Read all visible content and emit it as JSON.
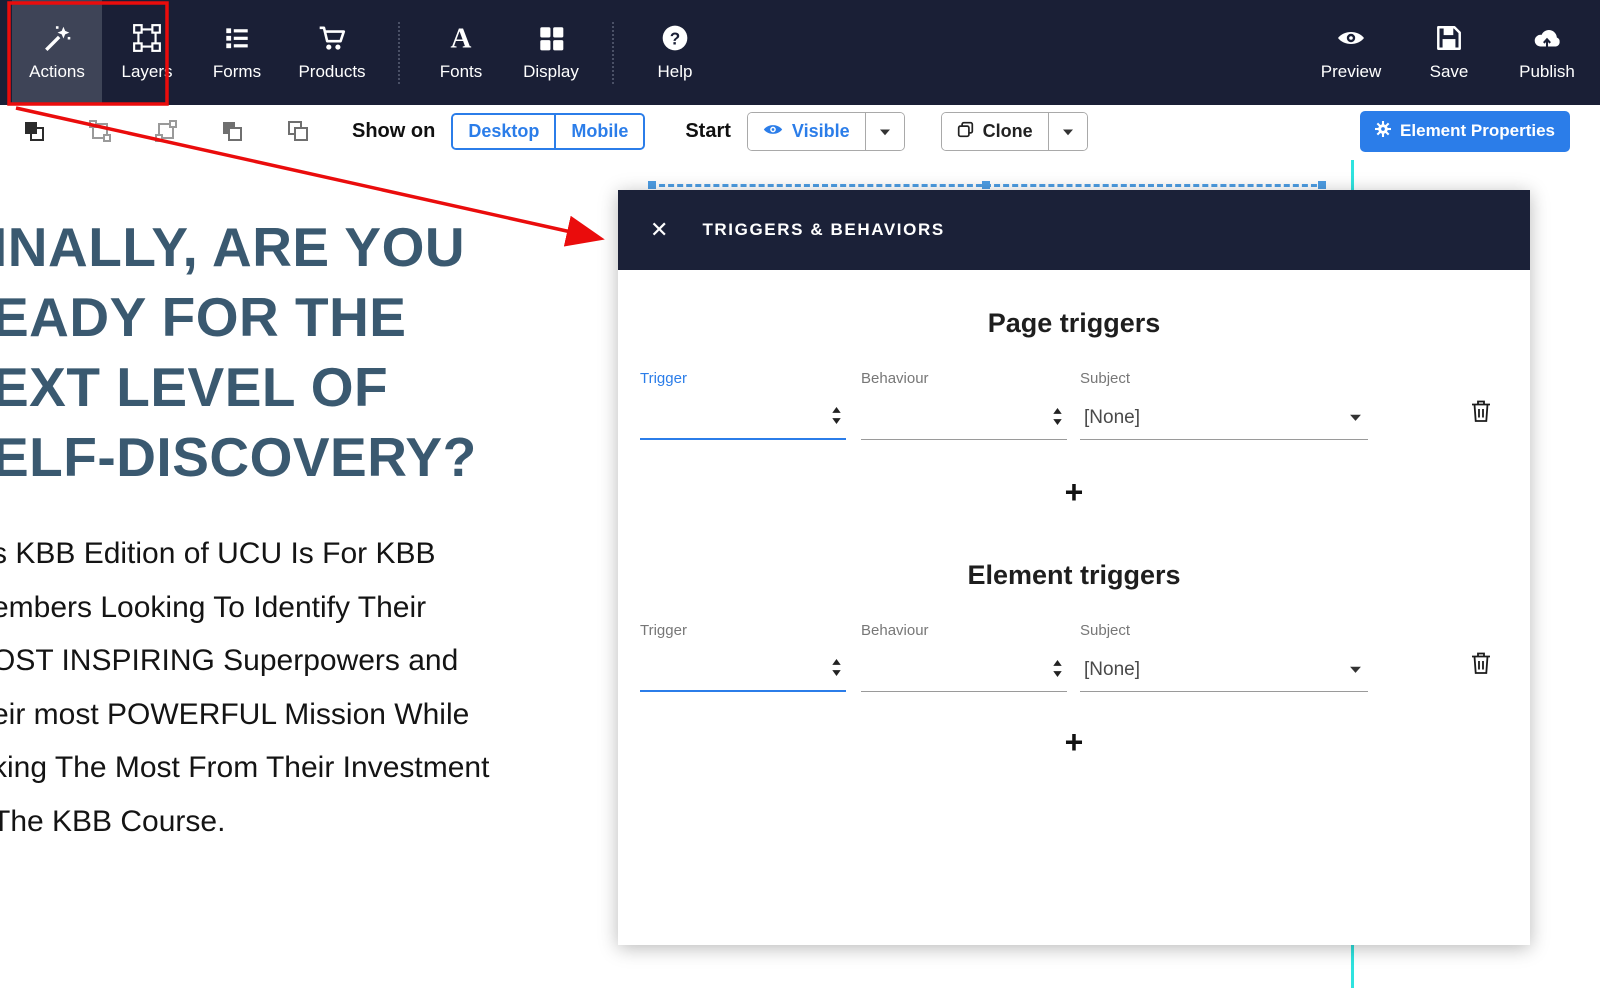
{
  "colors": {
    "topbar_bg": "#1a1f36",
    "accent_blue": "#2b7de9",
    "heading_color": "#3a5970",
    "annotation_red": "#ea0c0c",
    "guide_cyan": "#2fe3df",
    "modal_header_bg": "#1b2138"
  },
  "topbar": {
    "items": [
      {
        "label": "Actions",
        "icon": "magic-wand-icon",
        "active": true
      },
      {
        "label": "Layers",
        "icon": "selection-layers-icon",
        "active": false
      },
      {
        "label": "Forms",
        "icon": "list-forms-icon",
        "active": false
      },
      {
        "label": "Products",
        "icon": "shopping-cart-icon",
        "active": false
      },
      {
        "label": "Fonts",
        "icon": "letter-a-icon",
        "active": false
      },
      {
        "label": "Display",
        "icon": "grid-display-icon",
        "active": false
      },
      {
        "label": "Help",
        "icon": "question-circle-icon",
        "active": false
      }
    ],
    "right_items": [
      {
        "label": "Preview",
        "icon": "eye-icon"
      },
      {
        "label": "Save",
        "icon": "floppy-save-icon"
      },
      {
        "label": "Publish",
        "icon": "cloud-upload-icon"
      }
    ]
  },
  "toolbar": {
    "show_on_label": "Show on",
    "device_options": [
      "Desktop",
      "Mobile"
    ],
    "start_label": "Start",
    "visibility": {
      "label": "Visible",
      "icon": "eye-icon"
    },
    "clone_label": "Clone",
    "clone_icon": "copy-icon",
    "element_properties_label": "Element Properties",
    "element_properties_icon": "gear-icon"
  },
  "canvas": {
    "heading_lines": [
      "INALLY, ARE YOU",
      "EADY FOR THE",
      "EXT LEVEL OF",
      "ELF-DISCOVERY?"
    ],
    "body_lines": [
      "s KBB Edition of UCU Is For KBB",
      "embers Looking To Identify Their",
      "OST INSPIRING Superpowers and",
      "eir most POWERFUL Mission While",
      "king The Most From Their Investment",
      "The KBB Course."
    ]
  },
  "modal": {
    "title": "TRIGGERS & BEHAVIORS",
    "close_label": "✕",
    "sections": [
      {
        "heading": "Page triggers",
        "trigger_label": "Trigger",
        "behaviour_label": "Behaviour",
        "subject_label": "Subject",
        "subject_value": "[None]",
        "add_label": "+"
      },
      {
        "heading": "Element triggers",
        "trigger_label": "Trigger",
        "behaviour_label": "Behaviour",
        "subject_label": "Subject",
        "subject_value": "[None]",
        "add_label": "+"
      }
    ]
  }
}
